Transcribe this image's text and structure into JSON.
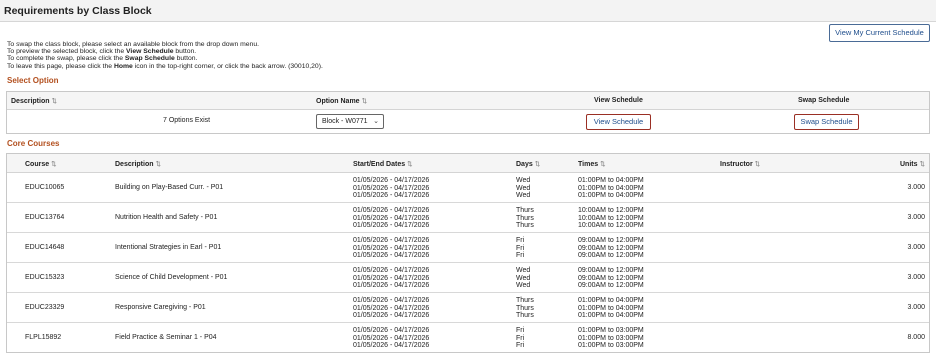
{
  "page": {
    "title": "Requirements by Class Block"
  },
  "top_button": "View My Current Schedule",
  "instructions": {
    "line1": "To swap the class block, please select an available block from the drop down menu.",
    "line2_pre": "To preview the selected block, click the ",
    "line2_bold": "View Schedule",
    "line2_post": " button.",
    "line3_pre": "To complete the swap, please click the ",
    "line3_bold": "Swap Schedule",
    "line3_post": " button.",
    "line4_pre": "To leave this page, please click the ",
    "line4_bold": "Home",
    "line4_post": " icon in the top-right corner, or click the back arrow. (30010,20)."
  },
  "select_option": {
    "section_title": "Select Option",
    "headers": {
      "description": "Description",
      "option_name": "Option Name",
      "view_schedule": "View Schedule",
      "swap_schedule": "Swap Schedule"
    },
    "row": {
      "description": "7 Options Exist",
      "selected_option": "Block - W0771",
      "view_button": "View Schedule",
      "swap_button": "Swap Schedule"
    }
  },
  "core_courses": {
    "section_title": "Core Courses",
    "headers": {
      "course": "Course",
      "description": "Description",
      "dates": "Start/End Dates",
      "days": "Days",
      "times": "Times",
      "instructor": "Instructor",
      "units": "Units"
    },
    "rows": [
      {
        "course": "EDUC10065",
        "description": "Building on Play-Based Curr. - P01",
        "dates": [
          "01/05/2026 - 04/17/2026",
          "01/05/2026 - 04/17/2026",
          "01/05/2026 - 04/17/2026"
        ],
        "days": [
          "Wed",
          "Wed",
          "Wed"
        ],
        "times": [
          "01:00PM to 04:00PM",
          "01:00PM to 04:00PM",
          "01:00PM to 04:00PM"
        ],
        "instructor": "",
        "units": "3.000"
      },
      {
        "course": "EDUC13764",
        "description": "Nutrition Health and Safety - P01",
        "dates": [
          "01/05/2026 - 04/17/2026",
          "01/05/2026 - 04/17/2026",
          "01/05/2026 - 04/17/2026"
        ],
        "days": [
          "Thurs",
          "Thurs",
          "Thurs"
        ],
        "times": [
          "10:00AM to 12:00PM",
          "10:00AM to 12:00PM",
          "10:00AM to 12:00PM"
        ],
        "instructor": "",
        "units": "3.000"
      },
      {
        "course": "EDUC14648",
        "description": "Intentional Strategies in Earl - P01",
        "dates": [
          "01/05/2026 - 04/17/2026",
          "01/05/2026 - 04/17/2026",
          "01/05/2026 - 04/17/2026"
        ],
        "days": [
          "Fri",
          "Fri",
          "Fri"
        ],
        "times": [
          "09:00AM to 12:00PM",
          "09:00AM to 12:00PM",
          "09:00AM to 12:00PM"
        ],
        "instructor": "",
        "units": "3.000"
      },
      {
        "course": "EDUC15323",
        "description": "Science of Child Development - P01",
        "dates": [
          "01/05/2026 - 04/17/2026",
          "01/05/2026 - 04/17/2026",
          "01/05/2026 - 04/17/2026"
        ],
        "days": [
          "Wed",
          "Wed",
          "Wed"
        ],
        "times": [
          "09:00AM to 12:00PM",
          "09:00AM to 12:00PM",
          "09:00AM to 12:00PM"
        ],
        "instructor": "",
        "units": "3.000"
      },
      {
        "course": "EDUC23329",
        "description": "Responsive Caregiving - P01",
        "dates": [
          "01/05/2026 - 04/17/2026",
          "01/05/2026 - 04/17/2026",
          "01/05/2026 - 04/17/2026"
        ],
        "days": [
          "Thurs",
          "Thurs",
          "Thurs"
        ],
        "times": [
          "01:00PM to 04:00PM",
          "01:00PM to 04:00PM",
          "01:00PM to 04:00PM"
        ],
        "instructor": "",
        "units": "3.000"
      },
      {
        "course": "FLPL15892",
        "description": "Field Practice & Seminar 1 - P04",
        "dates": [
          "01/05/2026 - 04/17/2026",
          "01/05/2026 - 04/17/2026",
          "01/05/2026 - 04/17/2026"
        ],
        "days": [
          "Fri",
          "Fri",
          "Fri"
        ],
        "times": [
          "01:00PM to 03:00PM",
          "01:00PM to 03:00PM",
          "01:00PM to 03:00PM"
        ],
        "instructor": "",
        "units": "8.000"
      }
    ]
  },
  "icons": {
    "sort": "sort-arrows-icon",
    "chevron": "chevron-down-icon"
  },
  "colors": {
    "section_title": "#b3501f",
    "button_border": "#9a2f24",
    "link_text": "#1f4e8c"
  }
}
